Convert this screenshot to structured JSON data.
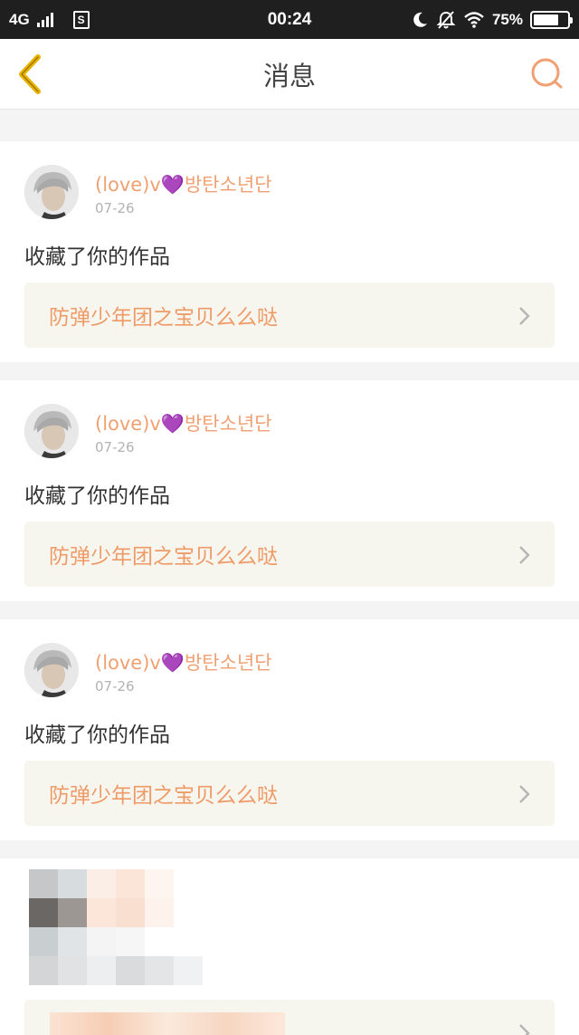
{
  "status_bar": {
    "network": "4G",
    "sim_label": "S",
    "time": "00:24",
    "battery_pct": "75%",
    "battery_level": 0.75,
    "icons": [
      "signal-icon",
      "sim-icon",
      "moon-icon",
      "bell-off-icon",
      "wifi-icon",
      "battery-icon"
    ]
  },
  "header": {
    "title": "消息",
    "back_icon": "chevron-left-icon",
    "search_icon": "search-icon",
    "accent_color": "#f0a072"
  },
  "feed": {
    "items": [
      {
        "user": "(love)v💜방탄소년단",
        "date": "07-26",
        "action": "收藏了你的作品",
        "work": "防弹少年团之宝贝么么哒"
      },
      {
        "user": "(love)v💜방탄소년단",
        "date": "07-26",
        "action": "收藏了你的作品",
        "work": "防弹少年团之宝贝么么哒"
      },
      {
        "user": "(love)v💜방탄소년단",
        "date": "07-26",
        "action": "收藏了你的作品",
        "work": "防弹少年团之宝贝么么哒"
      }
    ]
  }
}
